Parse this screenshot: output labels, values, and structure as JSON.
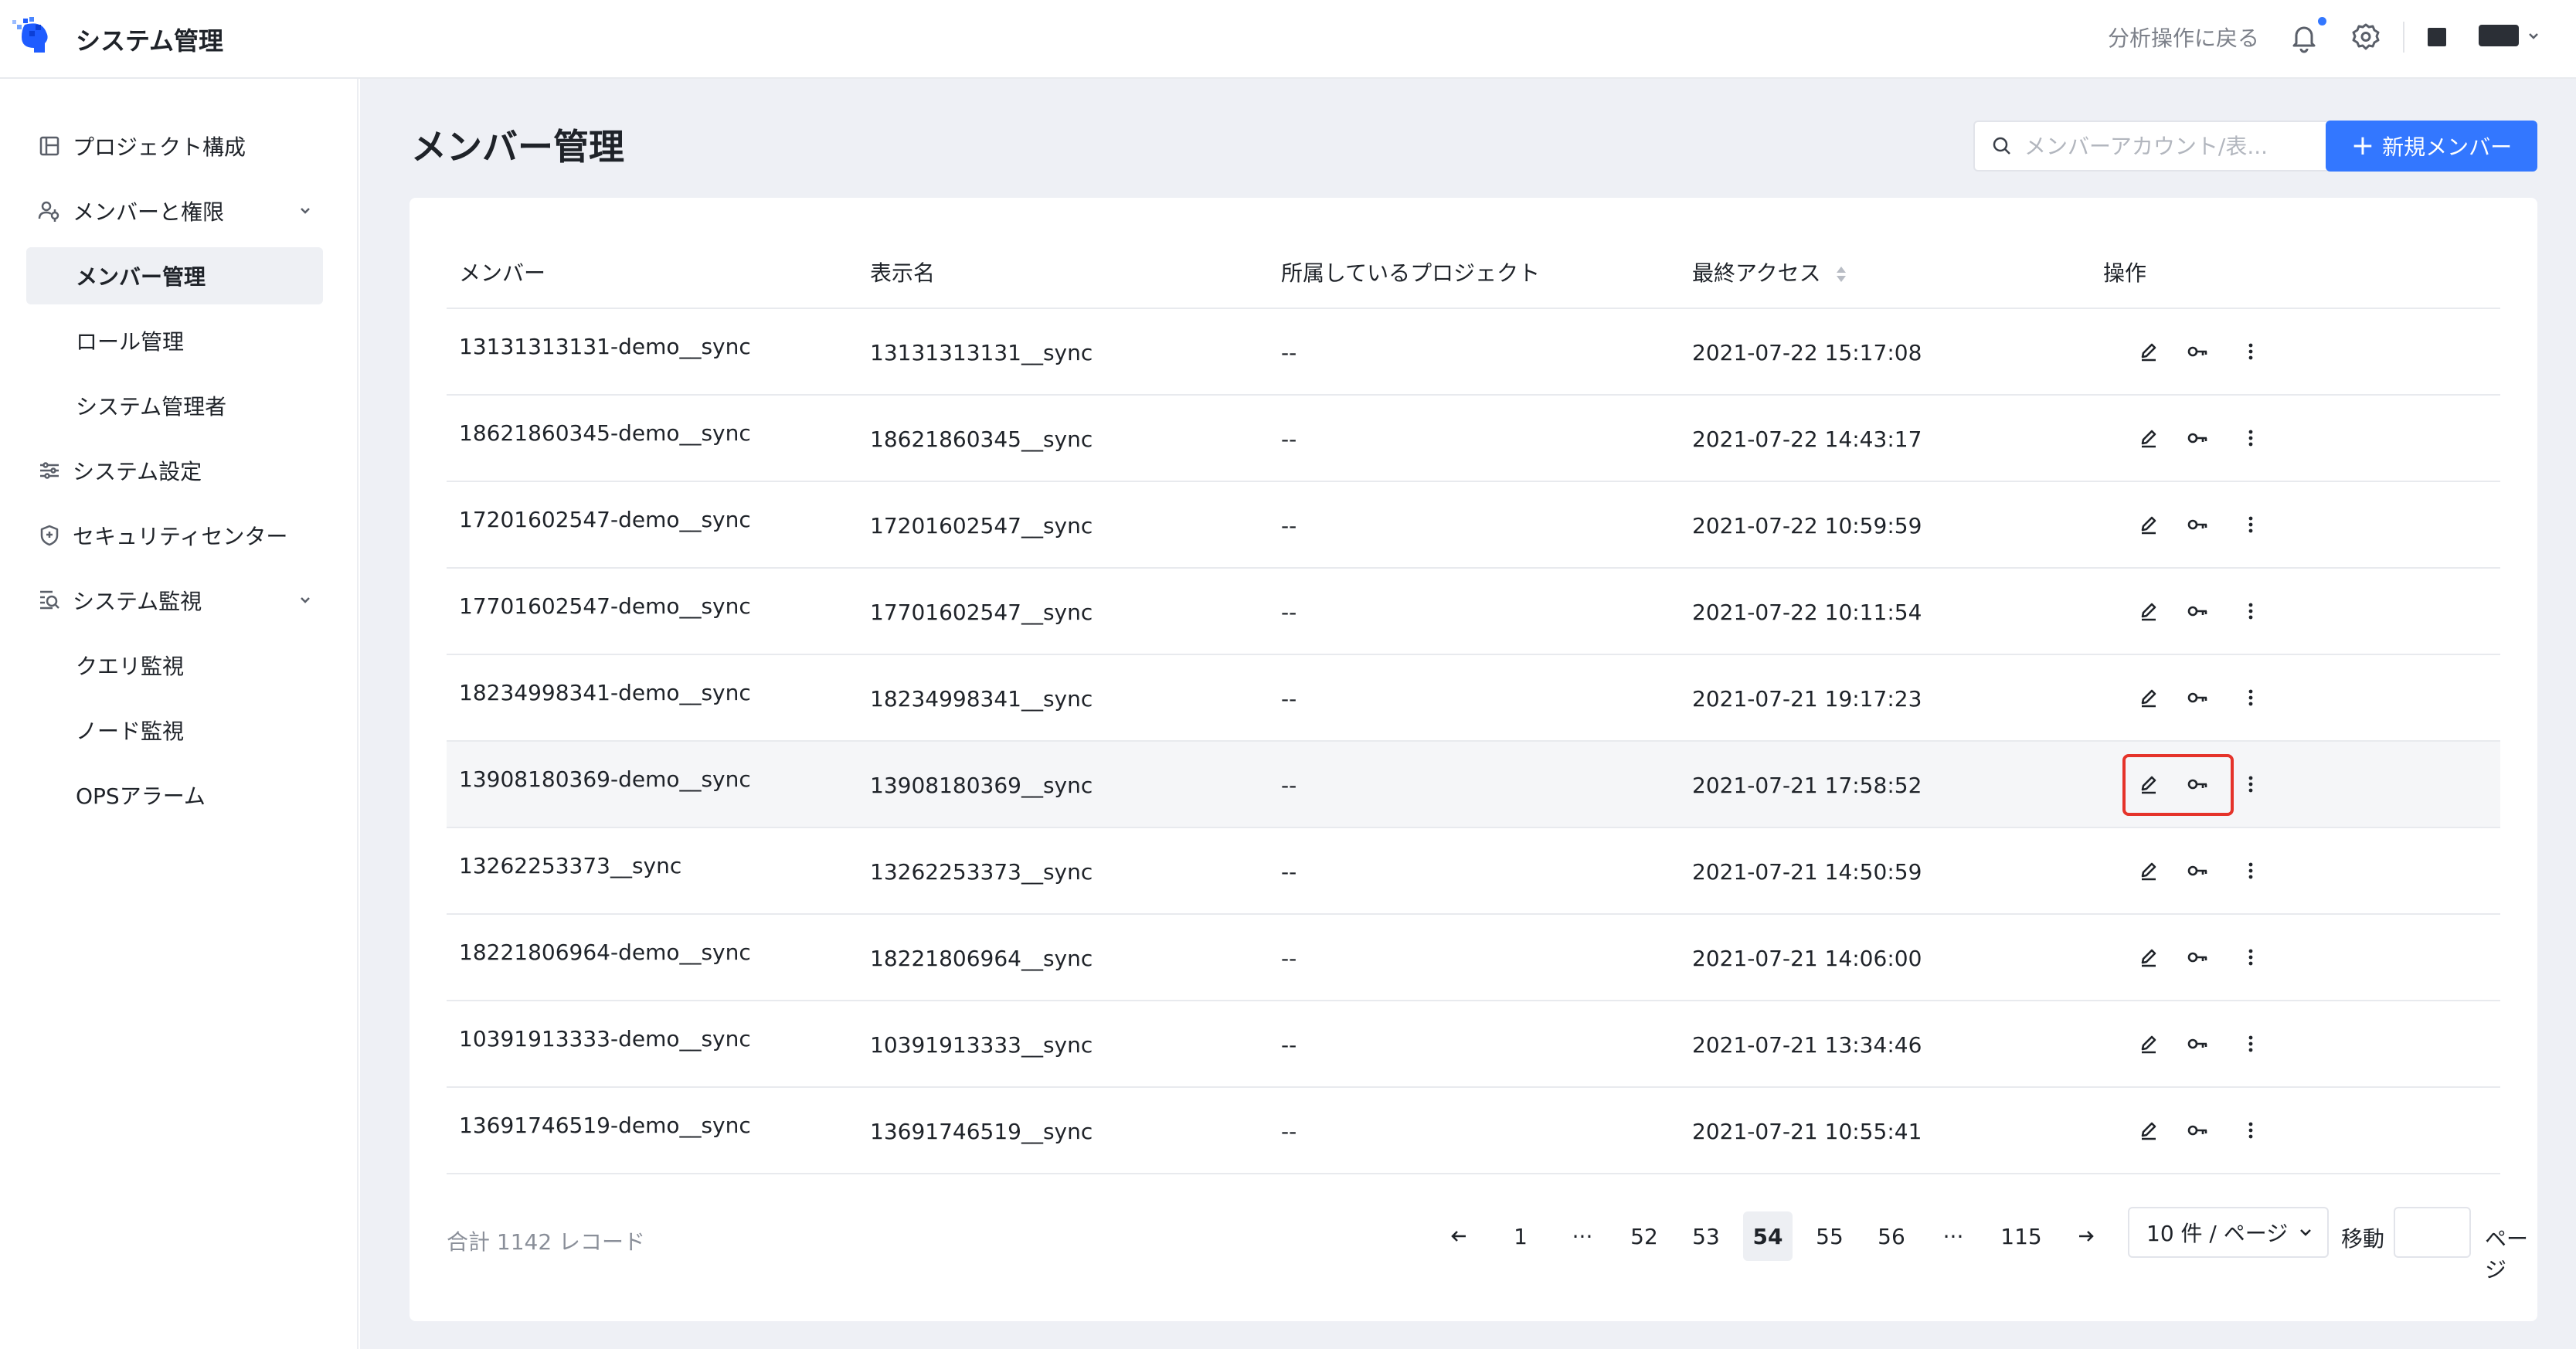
{
  "app": {
    "title": "システム管理"
  },
  "header": {
    "back_link": "分析操作に戻る",
    "icons": [
      "bell-icon",
      "gear-icon"
    ]
  },
  "sidebar": {
    "items": [
      {
        "label": "プロジェクト構成",
        "icon": "project-icon"
      },
      {
        "label": "メンバーと権限",
        "icon": "member-icon",
        "expanded": true
      },
      {
        "label": "メンバー管理",
        "active": true
      },
      {
        "label": "ロール管理"
      },
      {
        "label": "システム管理者"
      },
      {
        "label": "システム設定",
        "icon": "settings-sliders-icon"
      },
      {
        "label": "セキュリティセンター",
        "icon": "shield-icon"
      },
      {
        "label": "システム監視",
        "icon": "monitor-icon",
        "expanded": true
      },
      {
        "label": "クエリ監視"
      },
      {
        "label": "ノード監視"
      },
      {
        "label": "OPSアラーム"
      }
    ]
  },
  "main": {
    "title": "メンバー管理",
    "search": {
      "placeholder": "メンバーアカウント/表..."
    },
    "new_button": "新規メンバー",
    "table": {
      "columns": [
        "メンバー",
        "表示名",
        "所属しているプロジェクト",
        "最終アクセス",
        "操作"
      ],
      "rows": [
        {
          "member": "13131313131-demo__sync",
          "display": "13131313131__sync",
          "project": "--",
          "last_access": "2021-07-22 15:17:08"
        },
        {
          "member": "18621860345-demo__sync",
          "display": "18621860345__sync",
          "project": "--",
          "last_access": "2021-07-22 14:43:17"
        },
        {
          "member": "17201602547-demo__sync",
          "display": "17201602547__sync",
          "project": "--",
          "last_access": "2021-07-22 10:59:59"
        },
        {
          "member": "17701602547-demo__sync",
          "display": "17701602547__sync",
          "project": "--",
          "last_access": "2021-07-22 10:11:54"
        },
        {
          "member": "18234998341-demo__sync",
          "display": "18234998341__sync",
          "project": "--",
          "last_access": "2021-07-21 19:17:23"
        },
        {
          "member": "13908180369-demo__sync",
          "display": "13908180369__sync",
          "project": "--",
          "last_access": "2021-07-21 17:58:52"
        },
        {
          "member": "13262253373__sync",
          "display": "13262253373__sync",
          "project": "--",
          "last_access": "2021-07-21 14:50:59"
        },
        {
          "member": "18221806964-demo__sync",
          "display": "18221806964__sync",
          "project": "--",
          "last_access": "2021-07-21 14:06:00"
        },
        {
          "member": "10391913333-demo__sync",
          "display": "10391913333__sync",
          "project": "--",
          "last_access": "2021-07-21 13:34:46"
        },
        {
          "member": "13691746519-demo__sync",
          "display": "13691746519__sync",
          "project": "--",
          "last_access": "2021-07-21 10:55:41"
        }
      ]
    },
    "pagination": {
      "total": "合計 1142 レコード",
      "pages": [
        "1",
        "···",
        "52",
        "53",
        "54",
        "55",
        "56",
        "···",
        "115"
      ],
      "current": "54",
      "page_size": "10 件 / ページ",
      "jump_label": "移動",
      "page_suffix": "ページ"
    }
  },
  "colors": {
    "primary": "#3377ff",
    "highlight": "#e5332a",
    "bg": "#eef0f5"
  }
}
